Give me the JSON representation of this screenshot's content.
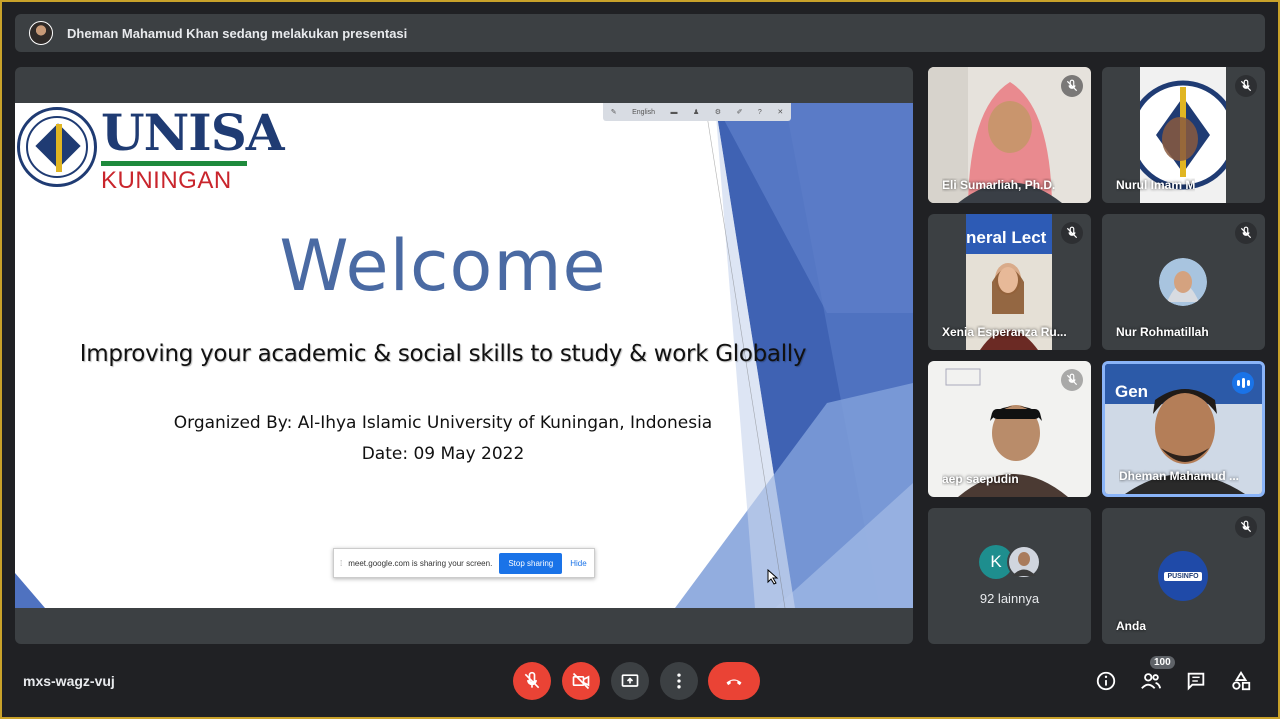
{
  "banner": {
    "text": "Dheman Mahamud Khan sedang melakukan presentasi"
  },
  "slide": {
    "logo_title": "UNISA",
    "logo_subtitle": "KUNINGAN",
    "toolbar_lang": "English",
    "welcome": "Welcome",
    "subtitle": "Improving your academic & social skills to study & work Globally",
    "organizer": "Organized By: Al-Ihya Islamic University of Kuningan, Indonesia",
    "date": "Date: 09 May 2022",
    "share_message": "meet.google.com is sharing your screen.",
    "stop_sharing": "Stop sharing",
    "hide": "Hide"
  },
  "participants": [
    {
      "name": "Eli Sumarliah, Ph.D.",
      "muted": true
    },
    {
      "name": "Nurul Imam M",
      "muted": true
    },
    {
      "name": "Xenia Esperanza Ru...",
      "muted": true,
      "video_text": "neral Lect"
    },
    {
      "name": "Nur Rohmatillah",
      "muted": true
    },
    {
      "name": "aep saepudin",
      "muted": true
    },
    {
      "name": "Dheman Mahamud ...",
      "muted": false,
      "speaking": true,
      "video_text": "Gen"
    },
    {
      "name": "92 lainnya",
      "avatar_letter": "K"
    },
    {
      "name": "Anda",
      "muted": true,
      "avatar_text": "PUSINFO"
    }
  ],
  "footer": {
    "meeting_code": "mxs-wagz-vuj",
    "people_count": "100"
  },
  "colors": {
    "background": "#202124",
    "tile": "#3c4043",
    "danger": "#ea4335",
    "accent": "#1a73e8",
    "slide_title": "#4a6aa3"
  }
}
